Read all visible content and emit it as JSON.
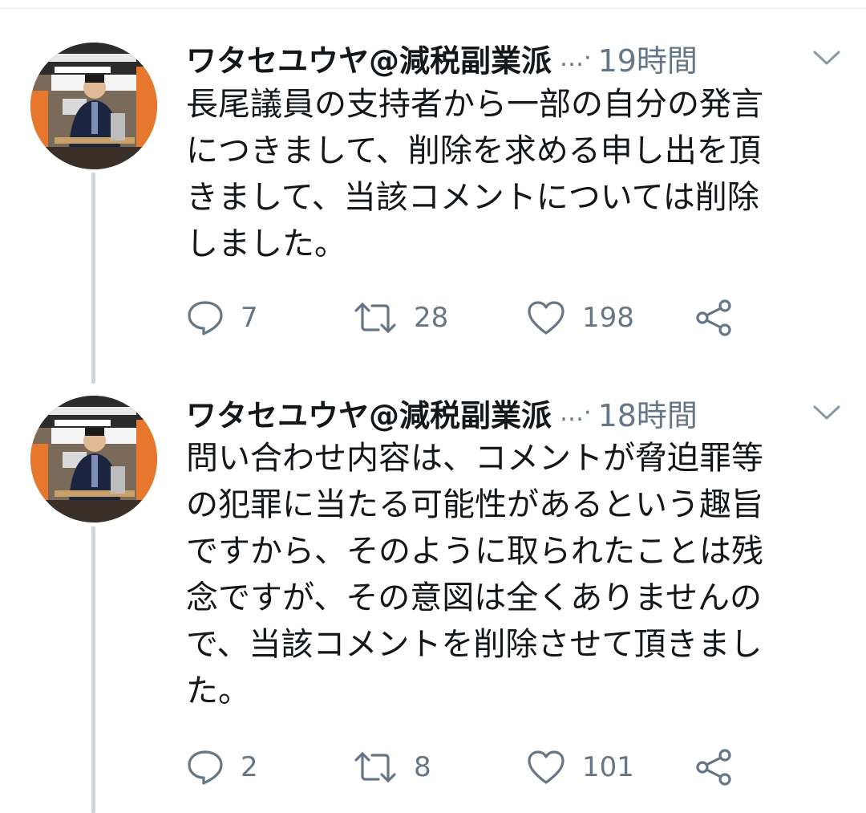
{
  "tweets": [
    {
      "author": "ワタセユウヤ@減税副業派",
      "ellipsis": "…·",
      "time": "19時間",
      "text": "長尾議員の支持者から一部の自分の発言\nにつきまして、削除を求める申し出を頂\nきまして、当該コメントについては削除\nしました。",
      "replies": "7",
      "retweets": "28",
      "likes": "198"
    },
    {
      "author": "ワタセユウヤ@減税副業派",
      "ellipsis": "…·",
      "time": "18時間",
      "text": "問い合わせ内容は、コメントが脅迫罪等\nの犯罪に当たる可能性があるという趣旨\nですから、そのように取られたことは残\n念ですが、その意図は全くありませんの\nで、当該コメントを削除させて頂きまし\nた。",
      "replies": "2",
      "retweets": "8",
      "likes": "101"
    }
  ],
  "icons": {
    "reply": "speech-bubble-icon",
    "retweet": "retweet-arrows-icon",
    "like": "heart-icon",
    "share": "share-icon",
    "menu": "chevron-down-icon"
  },
  "colors": {
    "text": "#14171a",
    "muted": "#657786",
    "thread_line": "#ccd6dd",
    "avatar_accent": "#e8772e"
  }
}
